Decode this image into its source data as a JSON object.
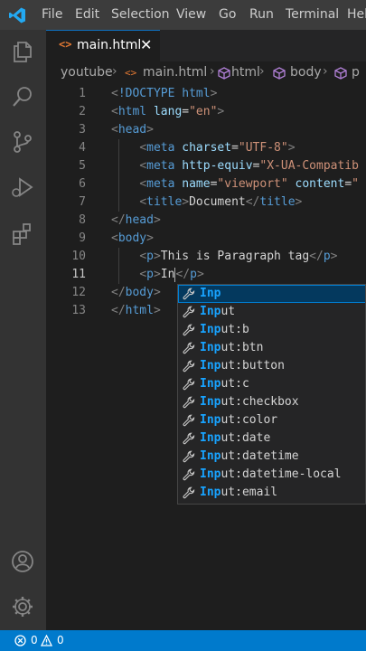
{
  "menu": [
    "File",
    "Edit",
    "Selection",
    "View",
    "Go",
    "Run",
    "Terminal",
    "Hel"
  ],
  "activity_icons": [
    "files-icon",
    "search-icon",
    "source-control-icon",
    "run-debug-icon",
    "extensions-icon",
    "account-icon",
    "settings-gear-icon"
  ],
  "tab": {
    "label": "main.html",
    "close": "✕",
    "icon": "<>"
  },
  "breadcrumb": [
    "youtube",
    "main.html",
    "html",
    "body",
    "p"
  ],
  "editor": {
    "lines": [
      {
        "n": "1",
        "code": "<!DOCTYPE html>"
      },
      {
        "n": "2",
        "code": "<html lang=\"en\">"
      },
      {
        "n": "3",
        "code": "<head>"
      },
      {
        "n": "4",
        "code": "    <meta charset=\"UTF-8\">"
      },
      {
        "n": "5",
        "code": "    <meta http-equiv=\"X-UA-Compatib"
      },
      {
        "n": "6",
        "code": "    <meta name=\"viewport\" content=\""
      },
      {
        "n": "7",
        "code": "    <title>Document</title>"
      },
      {
        "n": "8",
        "code": "</head>"
      },
      {
        "n": "9",
        "code": "<body>"
      },
      {
        "n": "10",
        "code": "    <p>This is Paragraph tag</p>"
      },
      {
        "n": "11",
        "code": "    <p>In</p>"
      },
      {
        "n": "12",
        "code": "</body>"
      },
      {
        "n": "13",
        "code": "</html>"
      }
    ]
  },
  "suggestions": {
    "match": "Inp",
    "items": [
      "Inp",
      "Input",
      "Input:b",
      "Input:btn",
      "Input:button",
      "Input:c",
      "Input:checkbox",
      "Input:color",
      "Input:date",
      "Input:datetime",
      "Input:datetime-local",
      "Input:email"
    ]
  },
  "status": {
    "errors": "0",
    "warnings": "0"
  },
  "colors": {
    "accent": "#007acc",
    "tag": "#569cd6",
    "attr": "#9cdcfe",
    "string": "#ce9178",
    "match": "#18a3ff"
  }
}
